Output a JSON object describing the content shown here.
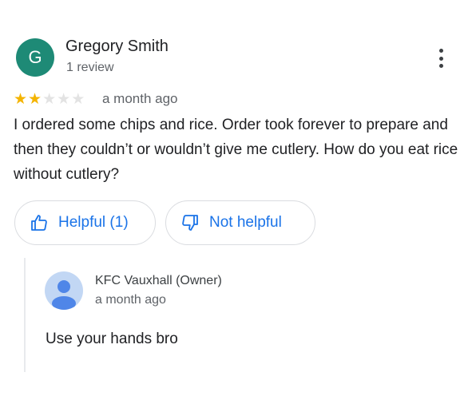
{
  "review": {
    "avatar_letter": "G",
    "avatar_color": "#1e8a76",
    "reviewer_name": "Gregory Smith",
    "review_count": "1 review",
    "rating": 2,
    "max_rating": 5,
    "star_color": "#f4b400",
    "time": "a month ago",
    "text": "I ordered some chips and rice. Order took forever to prepare and then they couldn’t or wouldn’t give me cutlery. How do you eat rice without cutlery?",
    "more_icon": "more-vert-icon"
  },
  "actions": {
    "helpful_label": "Helpful (1)",
    "helpful_icon": "thumb-up-icon",
    "not_helpful_label": "Not helpful",
    "not_helpful_icon": "thumb-down-icon",
    "accent_color": "#1a73e8"
  },
  "owner_reply": {
    "avatar_icon": "person-avatar-icon",
    "name": "KFC Vauxhall (Owner)",
    "time": "a month ago",
    "text": "Use your hands bro"
  }
}
